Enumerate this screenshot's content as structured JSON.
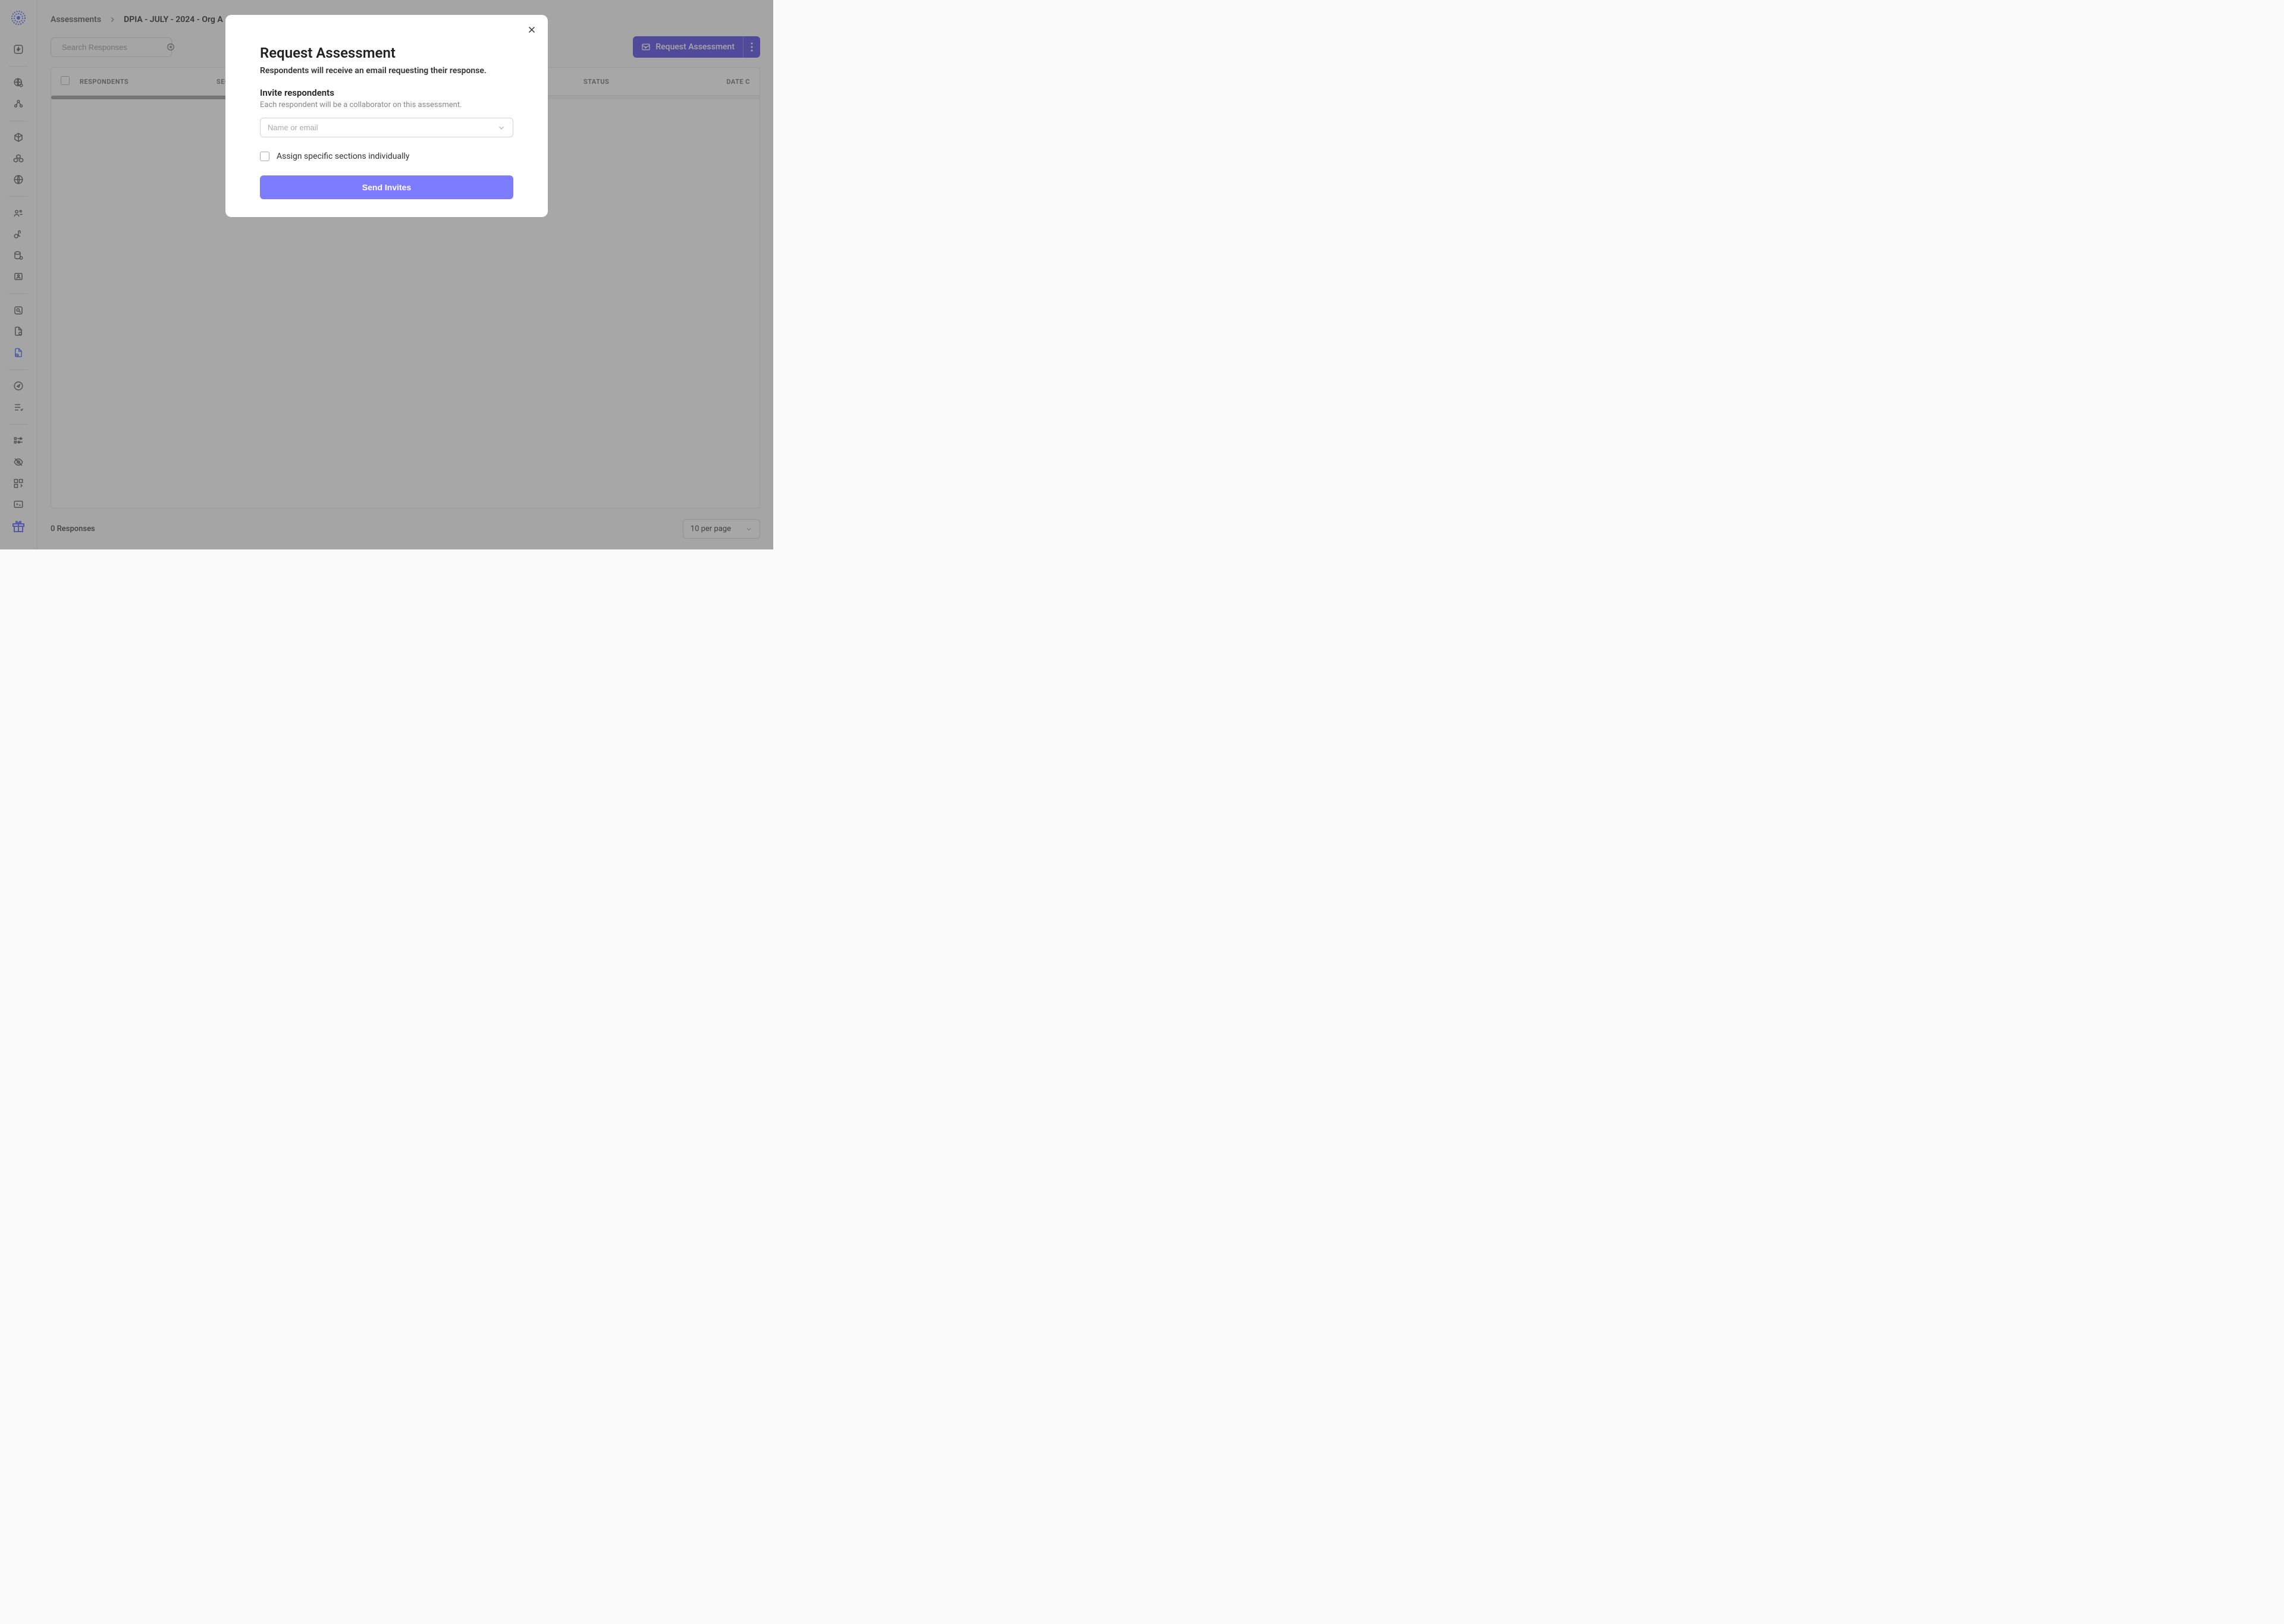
{
  "breadcrumb": {
    "parent": "Assessments",
    "current": "DPIA - JULY - 2024 - Org A"
  },
  "search": {
    "placeholder": "Search Responses"
  },
  "toolbar": {
    "request_label": "Request Assessment"
  },
  "table": {
    "headers": {
      "respondents": "Respondents",
      "sections": "Sec",
      "status": "Status",
      "date": "Date C"
    }
  },
  "footer": {
    "count": "0 Responses",
    "page_size": "10 per page"
  },
  "modal": {
    "title": "Request Assessment",
    "subtitle": "Respondents will receive an email requesting their response.",
    "invite_title": "Invite respondents",
    "invite_desc": "Each respondent will be a collaborator on this assessment.",
    "input_placeholder": "Name or email",
    "checkbox_label": "Assign specific sections individually",
    "submit_label": "Send Invites"
  }
}
